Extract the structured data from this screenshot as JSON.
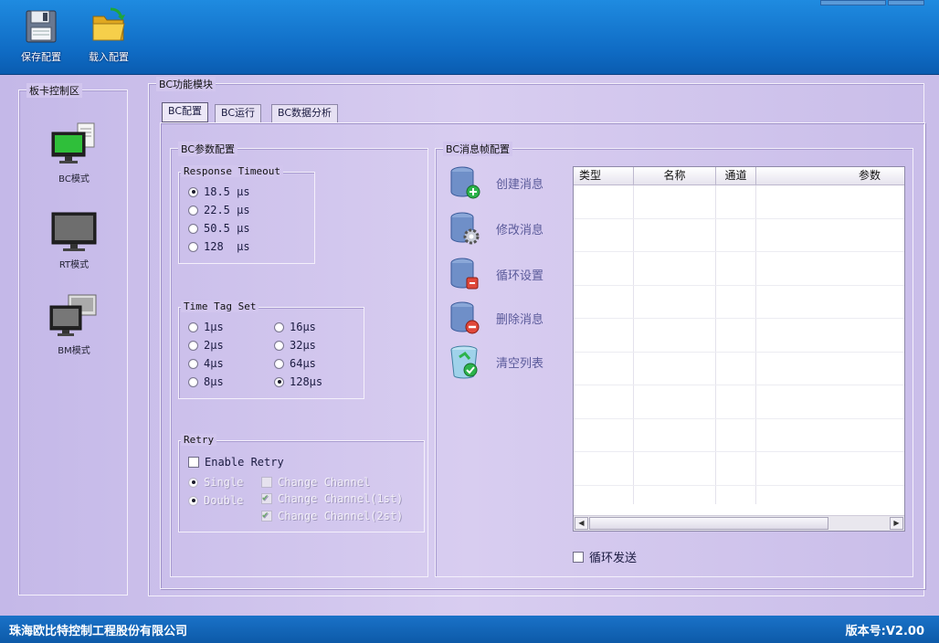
{
  "toolbar": {
    "save_label": "保存配置",
    "load_label": "载入配置"
  },
  "sidebar": {
    "title": "板卡控制区",
    "modes": [
      {
        "label": "BC模式"
      },
      {
        "label": "RT模式"
      },
      {
        "label": "BM模式"
      }
    ]
  },
  "module": {
    "title": "BC功能模块",
    "tabs": [
      {
        "label": "BC配置"
      },
      {
        "label": "BC运行"
      },
      {
        "label": "BC数据分析"
      }
    ]
  },
  "bc_params": {
    "title": "BC参数配置",
    "response_timeout": {
      "title": "Response Timeout",
      "options": [
        "18.5 μs",
        "22.5 μs",
        "50.5 μs",
        "128  μs"
      ],
      "selected_index": 0
    },
    "time_tag": {
      "title": "Time Tag Set",
      "options": [
        "1μs",
        "2μs",
        "4μs",
        "8μs",
        "16μs",
        "32μs",
        "64μs",
        "128μs"
      ],
      "selected_index": 7
    },
    "retry": {
      "title": "Retry",
      "enable_label": "Enable Retry",
      "enable_checked": false,
      "single_label": "Single",
      "double_label": "Double",
      "change_channel_label": "Change Channel",
      "change_channel_1st_label": "Change Channel(1st)",
      "change_channel_2st_label": "Change Channel(2st)"
    }
  },
  "msg_frame": {
    "title": "BC消息帧配置",
    "actions": [
      {
        "label": "创建消息",
        "icon": "db-add-icon"
      },
      {
        "label": "修改消息",
        "icon": "db-gear-icon"
      },
      {
        "label": "循环设置",
        "icon": "db-cycle-icon"
      },
      {
        "label": "删除消息",
        "icon": "db-delete-icon"
      },
      {
        "label": "清空列表",
        "icon": "recycle-bin-icon"
      }
    ],
    "table": {
      "columns": [
        "类型",
        "名称",
        "通道",
        "参数"
      ],
      "rows": []
    },
    "loop_send_label": "循环发送",
    "loop_send_checked": false
  },
  "statusbar": {
    "company": "珠海欧比特控制工程股份有限公司",
    "version": "版本号:V2.00"
  }
}
